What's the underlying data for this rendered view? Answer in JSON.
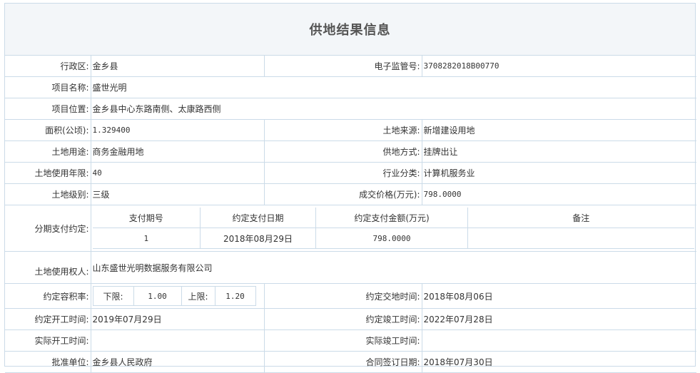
{
  "page": {
    "title": "供地结果信息"
  },
  "fields": {
    "district_label": "行政区:",
    "district_value": "金乡县",
    "supervision_label": "电子监管号:",
    "supervision_value": "3708282018B00770",
    "project_name_label": "项目名称:",
    "project_name_value": "盛世光明",
    "project_location_label": "项目位置:",
    "project_location_value": "金乡县中心东路南侧、太康路西侧",
    "area_label": "面积(公顷):",
    "area_value": "1.329400",
    "land_source_label": "土地来源:",
    "land_source_value": "新增建设用地",
    "land_use_label": "土地用途:",
    "land_use_value": "商务金融用地",
    "supply_method_label": "供地方式:",
    "supply_method_value": "挂牌出让",
    "use_years_label": "土地使用年限:",
    "use_years_value": "40",
    "industry_label": "行业分类:",
    "industry_value": "计算机服务业",
    "land_grade_label": "土地级别:",
    "land_grade_value": "三级",
    "price_label": "成交价格(万元):",
    "price_value": "798.0000",
    "installment_label": "分期支付约定:",
    "land_user_label": "土地使用权人:",
    "land_user_value": "山东盛世光明数据服务有限公司",
    "far_label": "约定容积率:",
    "far_lower_label": "下限:",
    "far_lower_value": "1.00",
    "far_upper_label": "上限:",
    "far_upper_value": "1.20",
    "delivery_label": "约定交地时间:",
    "delivery_value": "2018年08月06日",
    "start_label": "约定开工时间:",
    "start_value": "2019年07月29日",
    "completion_label": "约定竣工时间:",
    "completion_value": "2022年07月28日",
    "actual_start_label": "实际开工时间:",
    "actual_start_value": "",
    "actual_completion_label": "实际竣工时间:",
    "actual_completion_value": "",
    "approver_label": "批准单位:",
    "approver_value": "金乡县人民政府",
    "contract_date_label": "合同签订日期:",
    "contract_date_value": "2018年07月30日"
  },
  "installments": {
    "headers": [
      "支付期号",
      "约定支付日期",
      "约定支付金额(万元)",
      "备注"
    ],
    "rows": [
      {
        "period": "1",
        "date": "2018年08月29日",
        "amount": "798.0000",
        "note": ""
      }
    ]
  }
}
